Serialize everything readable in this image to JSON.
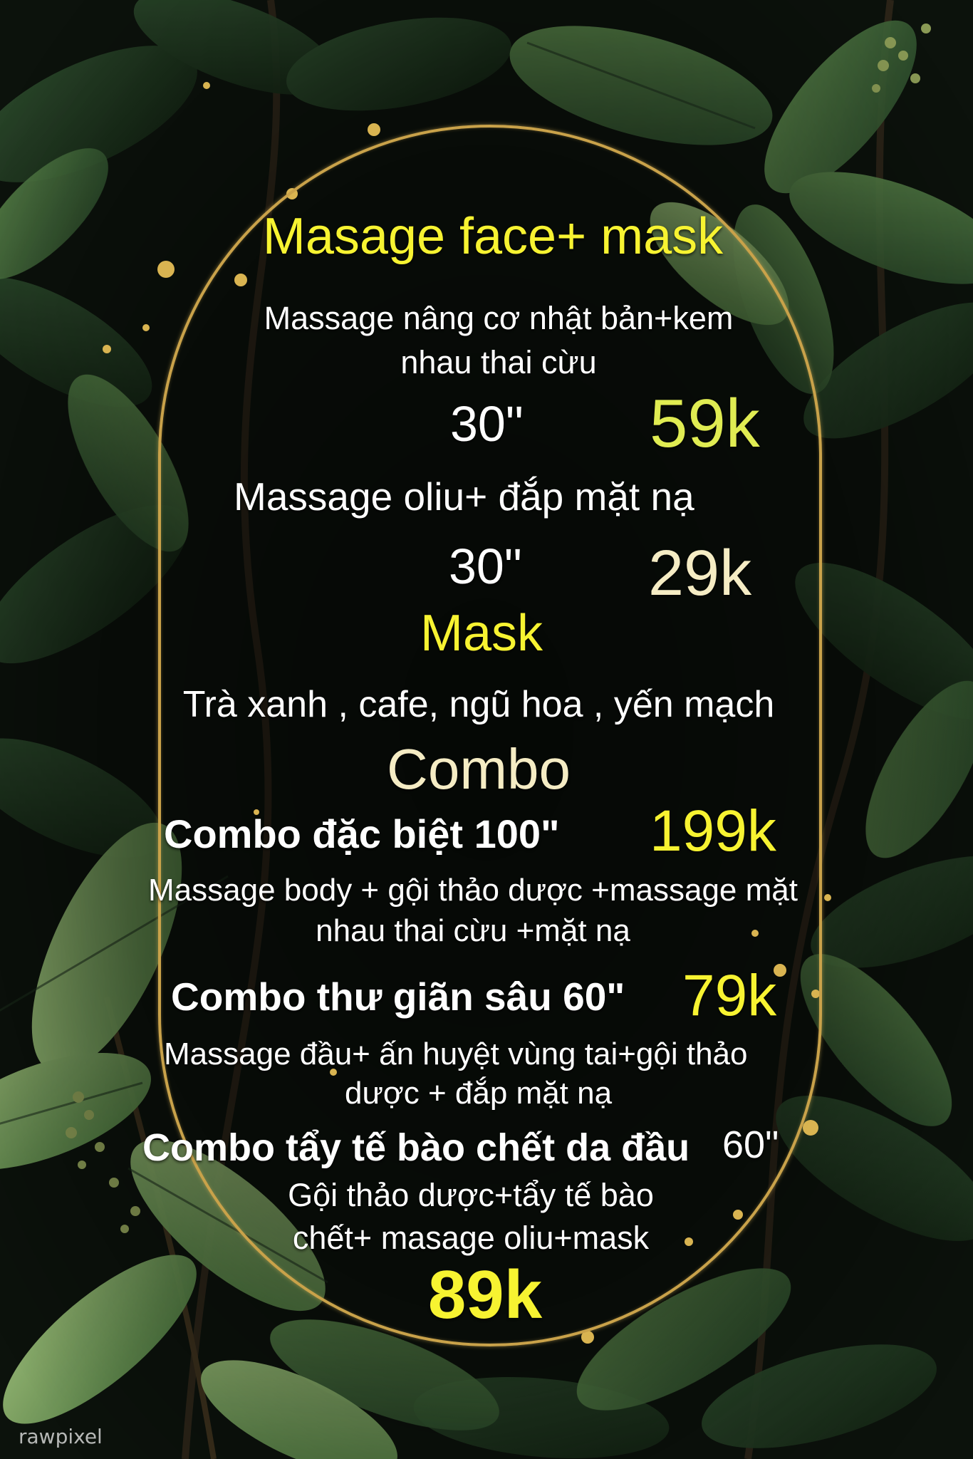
{
  "colors": {
    "background": "#0b0f0b",
    "leaf_dark": "#1f3a22",
    "leaf_mid": "#3f6b3c",
    "leaf_light": "#7fa35f",
    "gold": "#c9a24a",
    "title_yellow": "#f7f331",
    "price_lime": "#e0ec52",
    "cream": "#f5ecc4",
    "white": "#ffffff"
  },
  "section_face": {
    "title": "Masage face+ mask",
    "item1_line1": "Massage nâng cơ nhật bản+kem",
    "item1_line2": "nhau thai cừu",
    "item1_duration": "30\"",
    "item1_price": "59k",
    "item2_name": "Massage oliu+ đắp mặt nạ",
    "item2_duration": "30\"",
    "item2_price": "29k"
  },
  "section_mask": {
    "title": "Mask",
    "options": "Trà xanh , cafe, ngũ hoa , yến mạch"
  },
  "section_combo": {
    "title": "Combo",
    "combo1_name": "Combo đặc biệt 100\"",
    "combo1_price": "199k",
    "combo1_desc_line1": "Massage body + gội thảo dược +massage mặt",
    "combo1_desc_line2": "nhau thai cừu +mặt nạ",
    "combo2_name": "Combo thư giãn sâu 60\"",
    "combo2_price": "79k",
    "combo2_desc_line1": "Massage đầu+ ấn huyệt vùng tai+gội thảo",
    "combo2_desc_line2": "dược + đắp mặt nạ",
    "combo3_name": "Combo tẩy tế bào chết da đầu",
    "combo3_duration": "60\"",
    "combo3_desc_line1": "Gội thảo dược+tẩy tế bào",
    "combo3_desc_line2": "chết+ masage oliu+mask",
    "combo3_price": "89k"
  },
  "watermark": "rawpixel"
}
